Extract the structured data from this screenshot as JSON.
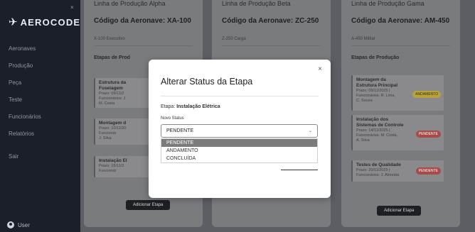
{
  "sidebar": {
    "close": "×",
    "logo_icon": "✈",
    "logo_text": "AEROCODE",
    "items": [
      {
        "label": "Aeronaves"
      },
      {
        "label": "Produção"
      },
      {
        "label": "Peça"
      },
      {
        "label": "Teste"
      },
      {
        "label": "Funcionários"
      },
      {
        "label": "Relatórios"
      },
      {
        "label": "Sair"
      }
    ],
    "user_label": "User"
  },
  "panels": [
    {
      "line": "Linha de Produção Alpha",
      "code": "Código da Aeronave: XA-100",
      "model": "X-100 Executivo",
      "etapas_title": "Etapas de Prod",
      "steps": [
        {
          "name": "Estrutura da",
          "name2": "Fuselagem",
          "info": "Prazo: 09/11/2",
          "info2": "Funcionários: J",
          "info3": "M. Costa"
        },
        {
          "name": "Montagem d",
          "info": "Prazo: 10/11/20",
          "info2": "Funcionár",
          "info3": "J. Silva"
        },
        {
          "name": "Instalação El",
          "info": "Prazo: 15/11/2",
          "info2": "Funcionár"
        }
      ],
      "add_label": "Adicionar Etapa"
    },
    {
      "line": "Linha de Produção Beta",
      "code": "Código da Aeronave: ZC-250",
      "model": "Z-250 Carga"
    },
    {
      "line": "Linha de Produção Gama",
      "code": "Código da Aeronave: AM-450",
      "model": "A-450 Militar",
      "etapas_title": "Etapas de Produção",
      "steps": [
        {
          "name": "Montagem da",
          "name2": "Estrutura Principal",
          "info": "Prazo: 09/11/2025 |",
          "info2": "Funcionários: R. Lima,",
          "info3": "C. Souza",
          "badge": "ANDAMENTO"
        },
        {
          "name": "Instalação dos",
          "name2": "Sistemas de Controle",
          "info": "Prazo: 14/11/2025 |",
          "info2": "Funcionários: M. Costa,",
          "info3": "A. Silva",
          "badge": "PENDENTE"
        },
        {
          "name": "Testes de Qualidade",
          "info": "Prazo: 20/11/2025 |",
          "info2": "Funcionários: J. Almeida",
          "badge": "PENDENTE"
        }
      ],
      "add_label": "Adicionar Etapa"
    }
  ],
  "modal": {
    "title": "Alterar Status da Etapa",
    "close": "×",
    "stage_prefix": "Etapa:",
    "stage_name": "Instalação Elétrica",
    "status_label": "Novo Status",
    "selected": "PENDENTE",
    "options": [
      "PENDENTE",
      "ANDAMENTO",
      "CONCLUÍDA"
    ]
  },
  "colors": {
    "sidebar_bg": "#1b1f2a",
    "badge_pendente": "#a64a4a",
    "badge_andamento": "#b7a23b"
  }
}
